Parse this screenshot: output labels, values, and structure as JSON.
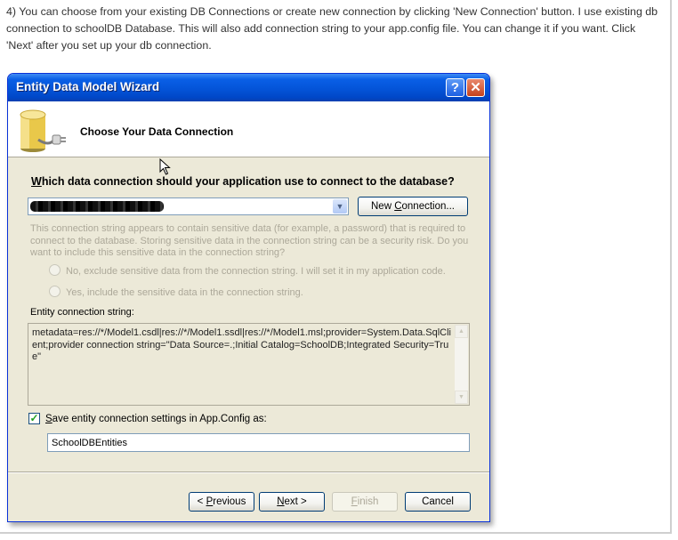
{
  "intro": {
    "text": "4) You can choose from your existing DB Connections or create new connection by clicking 'New Connection' button. I use existing db connection to schoolDB Database. This will also add connection string to your app.config file. You can change it if you want. Click 'Next' after you set up your db connection."
  },
  "dialog": {
    "title": "Entity Data Model Wizard",
    "help_label": "?",
    "close_label": "✕",
    "page_heading": "Choose Your Data Connection",
    "question_u": "W",
    "question_rest": "hich data connection should your application use to connect to the database?",
    "connection_value": "",
    "dropdown_arrow": "▼",
    "new_connection_pre": "New ",
    "new_connection_u": "C",
    "new_connection_post": "onnection...",
    "sensitive_text": "This connection string appears to contain sensitive data (for example, a password) that is required to connect to the database. Storing sensitive data in the connection string can be a security risk. Do you want to include this sensitive data in the connection string?",
    "radio_exclude": "No, exclude sensitive data from the connection string. I will set it in my application code.",
    "radio_include": "Yes, include the sensitive data in the connection string.",
    "entity_conn_label": "Entity connection string:",
    "entity_conn_value": "metadata=res://*/Model1.csdl|res://*/Model1.ssdl|res://*/Model1.msl;provider=System.Data.SqlClient;provider connection string=\"Data Source=.;Initial Catalog=SchoolDB;Integrated Security=True\"",
    "save_checked": true,
    "save_label_u": "S",
    "save_label_rest": "ave entity connection settings in App.Config as:",
    "entities_name": "SchoolDBEntities",
    "buttons": {
      "previous_pre": "< ",
      "previous_u": "P",
      "previous_post": "revious",
      "next_u": "N",
      "next_post": "ext >",
      "finish_u": "F",
      "finish_post": "inish",
      "cancel": "Cancel"
    }
  }
}
